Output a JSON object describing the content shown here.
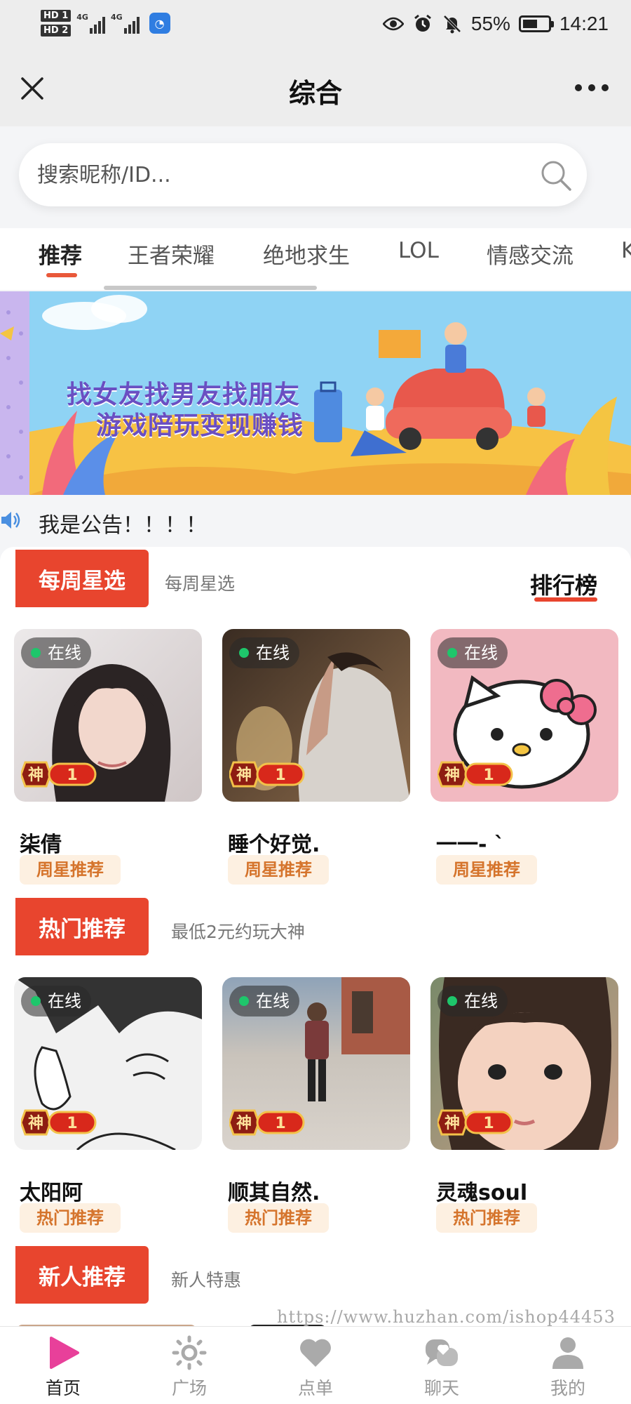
{
  "status_bar": {
    "sim1": "HD 1",
    "sim2": "HD 2",
    "net1": "4G",
    "net2": "4G",
    "battery": "55%",
    "time": "14:21"
  },
  "nav": {
    "title": "综合"
  },
  "search": {
    "placeholder": "搜索昵称/ID..."
  },
  "tabs": [
    {
      "label": "推荐",
      "active": true
    },
    {
      "label": "王者荣耀"
    },
    {
      "label": "绝地求生"
    },
    {
      "label": "LOL"
    },
    {
      "label": "情感交流"
    },
    {
      "label": "K"
    }
  ],
  "banner": {
    "line1": "找女友找男友找朋友",
    "line2": "游戏陪玩变现赚钱"
  },
  "notice": {
    "text": "我是公告！！！！"
  },
  "sections": [
    {
      "title": "每周星选",
      "subtitle": "每周星选",
      "action": "排行榜",
      "cards": [
        {
          "status": "在线",
          "rank_char": "神",
          "rank_num": "1",
          "name": "柒倩",
          "tag": "周星推荐"
        },
        {
          "status": "在线",
          "rank_char": "神",
          "rank_num": "1",
          "name": "睡个好觉.",
          "tag": "周星推荐"
        },
        {
          "status": "在线",
          "rank_char": "神",
          "rank_num": "1",
          "name": "一一-  `",
          "tag": "周星推荐"
        }
      ]
    },
    {
      "title": "热门推荐",
      "subtitle": "最低2元约玩大神",
      "cards": [
        {
          "status": "在线",
          "rank_char": "神",
          "rank_num": "1",
          "name": "太阳阿",
          "tag": "热门推荐"
        },
        {
          "status": "在线",
          "rank_char": "神",
          "rank_num": "1",
          "name": "顺其自然.",
          "tag": "热门推荐"
        },
        {
          "status": "在线",
          "rank_char": "神",
          "rank_num": "1",
          "name": "灵魂soul",
          "tag": "热门推荐"
        }
      ]
    },
    {
      "title": "新人推荐",
      "subtitle": "新人特惠"
    }
  ],
  "watermark": "https://www.huzhan.com/ishop44453",
  "bottom_nav": [
    {
      "label": "首页",
      "icon": "play-icon",
      "active": true
    },
    {
      "label": "广场",
      "icon": "sun-icon"
    },
    {
      "label": "点单",
      "icon": "heart-icon"
    },
    {
      "label": "聊天",
      "icon": "chat-icon"
    },
    {
      "label": "我的",
      "icon": "user-icon"
    }
  ],
  "colors": {
    "accent": "#e8452e",
    "tag_text": "#d5742c",
    "online_dot": "#1ec66b",
    "active_nav": "#e8409a"
  }
}
